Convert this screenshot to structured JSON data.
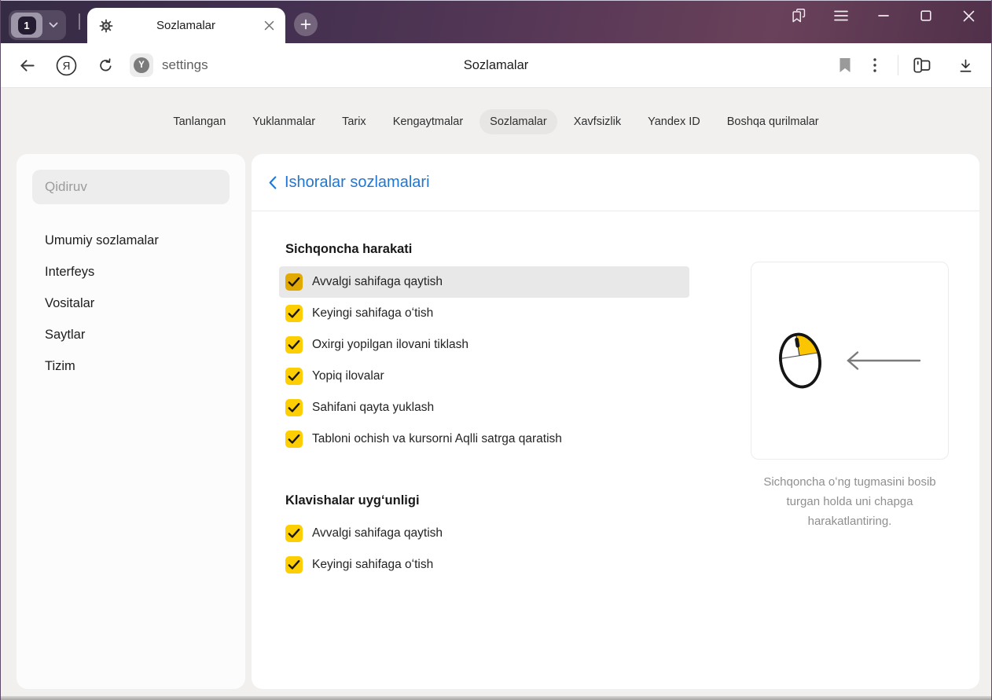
{
  "titlebar": {
    "tab_count": "1",
    "tab_title": "Sozlamalar"
  },
  "toolbar": {
    "browser_logo_letter": "Я",
    "protect_badge_letter": "Y",
    "address": "settings",
    "page_title": "Sozlamalar"
  },
  "navtabs": [
    {
      "label": "Tanlangan"
    },
    {
      "label": "Yuklanmalar"
    },
    {
      "label": "Tarix"
    },
    {
      "label": "Kengaytmalar"
    },
    {
      "label": "Sozlamalar",
      "active": true
    },
    {
      "label": "Xavfsizlik"
    },
    {
      "label": "Yandex ID"
    },
    {
      "label": "Boshqa qurilmalar"
    }
  ],
  "sidebar": {
    "search_placeholder": "Qidiruv",
    "items": [
      {
        "label": "Umumiy sozlamalar"
      },
      {
        "label": "Interfeys"
      },
      {
        "label": "Vositalar"
      },
      {
        "label": "Saytlar"
      },
      {
        "label": "Tizim"
      }
    ]
  },
  "main": {
    "title": "Ishoralar sozlamalari",
    "sections": [
      {
        "title": "Sichqoncha harakati",
        "items": [
          {
            "label": "Avvalgi sahifaga qaytish",
            "checked": true,
            "highlighted": true
          },
          {
            "label": "Keyingi sahifaga oʻtish",
            "checked": true
          },
          {
            "label": "Oxirgi yopilgan ilovani tiklash",
            "checked": true
          },
          {
            "label": "Yopiq ilovalar",
            "checked": true
          },
          {
            "label": "Sahifani qayta yuklash",
            "checked": true
          },
          {
            "label": "Tabloni ochish va kursorni Aqlli satrga qaratish",
            "checked": true
          }
        ]
      },
      {
        "title": "Klavishalar uygʻunligi",
        "items": [
          {
            "label": "Avvalgi sahifaga qaytish",
            "checked": true
          },
          {
            "label": "Keyingi sahifaga oʻtish",
            "checked": true
          }
        ]
      }
    ],
    "illustration": {
      "caption": "Sichqoncha oʻng tugmasini bosib turgan holda uni chapga harakatlantiring."
    }
  },
  "colors": {
    "accent_yellow": "#fdce02",
    "accent_yellow_active": "#e2a902",
    "link_blue": "#2077d2",
    "titlebar_purple": "#553756"
  }
}
